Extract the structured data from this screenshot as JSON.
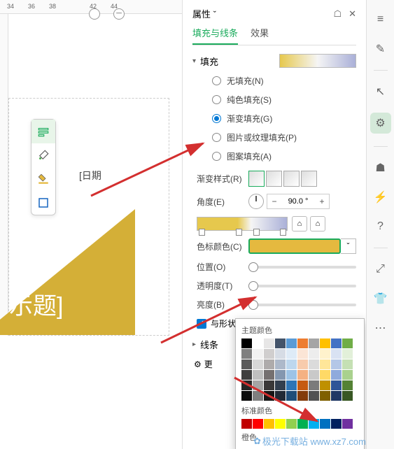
{
  "ruler": {
    "m34": "34",
    "m36": "36",
    "m38": "38",
    "m42": "42",
    "m44": "44"
  },
  "canvas": {
    "date_placeholder": "[日期",
    "title_text": "示题]"
  },
  "panel": {
    "title": "属性",
    "tabs": {
      "fill_stroke": "填充与线条",
      "effects": "效果"
    },
    "fill_section": "填充",
    "fill_options": {
      "none": "无填充(N)",
      "solid": "纯色填充(S)",
      "gradient": "渐变填充(G)",
      "picture": "图片或纹理填充(P)",
      "pattern": "图案填充(A)"
    },
    "gradient_style": "渐变样式(R)",
    "angle": "角度(E)",
    "angle_value": "90.0 °",
    "stop_color": "色标颜色(C)",
    "position": "位置(O)",
    "transparency": "透明度(T)",
    "brightness": "亮度(B)",
    "rotate_with_shape": "与形状一起旋",
    "stroke_section": "线条",
    "more": "更"
  },
  "color_picker": {
    "theme_colors": "主题颜色",
    "standard_colors": "标准颜色",
    "orange_set": "橙色"
  },
  "symbols": {
    "minus": "−",
    "plus": "+",
    "caret": "ˇ",
    "close": "✕",
    "pin": "☖",
    "tri_down": "▾",
    "tri_right": "▸",
    "home": "⌂",
    "check": "✓",
    "refresh": "↻",
    "gear": "⚙",
    "flower": "✿"
  },
  "watermark": "极光下载站 www.xz7.com",
  "theme_palette": [
    [
      "#000000",
      "#ffffff",
      "#e7e6e6",
      "#44546a",
      "#5b9bd5",
      "#ed7d31",
      "#a5a5a5",
      "#ffc000",
      "#4472c4",
      "#70ad47"
    ],
    [
      "#7f7f7f",
      "#f2f2f2",
      "#d0cece",
      "#d6dce5",
      "#deebf7",
      "#fbe5d6",
      "#ededed",
      "#fff2cc",
      "#d9e2f3",
      "#e2f0d9"
    ],
    [
      "#595959",
      "#d8d8d8",
      "#aeabab",
      "#adb9ca",
      "#bdd7ee",
      "#f7cbac",
      "#dbdbdb",
      "#ffe699",
      "#b4c7e7",
      "#c5e0b4"
    ],
    [
      "#3f3f3f",
      "#bfbfbf",
      "#757070",
      "#8497b0",
      "#9dc3e6",
      "#f4b183",
      "#c9c9c9",
      "#ffd966",
      "#8faadc",
      "#a9d18e"
    ],
    [
      "#262626",
      "#a5a5a5",
      "#3a3838",
      "#323f4f",
      "#2e75b6",
      "#c55a11",
      "#7b7b7b",
      "#bf9000",
      "#2f5597",
      "#548235"
    ],
    [
      "#0c0c0c",
      "#7f7f7f",
      "#171616",
      "#222a35",
      "#1f4e79",
      "#833c0c",
      "#525252",
      "#7f6000",
      "#203864",
      "#385723"
    ]
  ],
  "standard_palette": [
    "#c00000",
    "#ff0000",
    "#ffc000",
    "#ffff00",
    "#92d050",
    "#00b050",
    "#00b0f0",
    "#0070c0",
    "#002060",
    "#7030a0"
  ]
}
